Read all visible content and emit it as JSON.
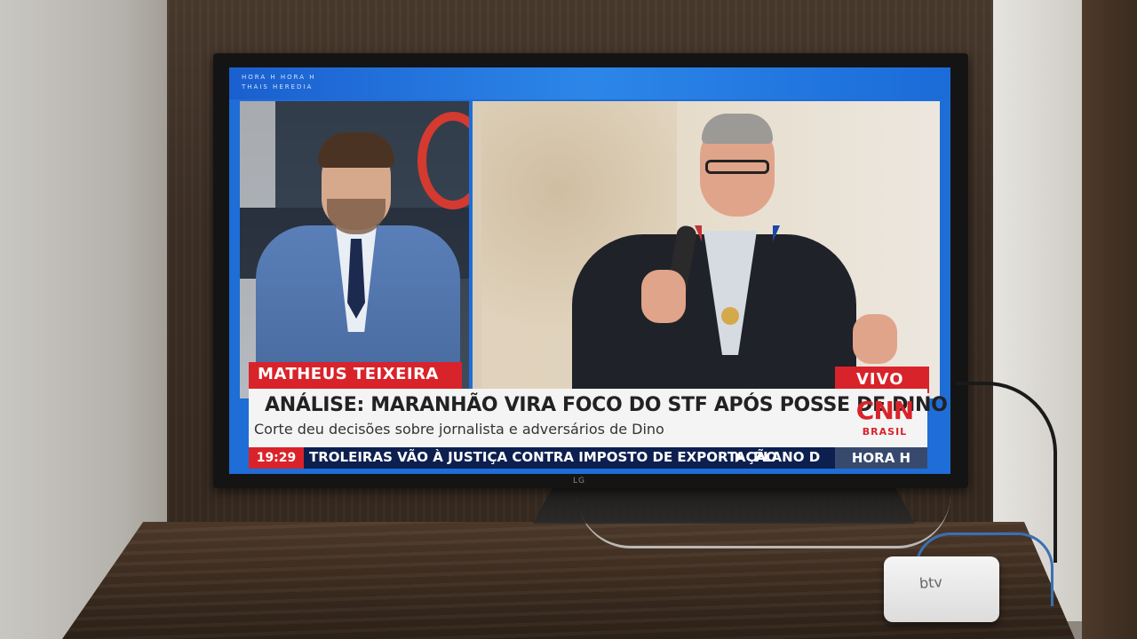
{
  "tv_brand": "LG",
  "broadcast": {
    "top_strip_text": [
      "HORA H  HORA H",
      "THAIS HEREDIA"
    ],
    "reporter_name": "MATHEUS TEIXEIRA",
    "live_label": "VIVO",
    "headline": "ANÁLISE: MARANHÃO VIRA FOCO DO STF APÓS POSSE DE DINO",
    "subheadline": "Corte deu decisões sobre jornalista e adversários de Dino",
    "channel": {
      "name": "CNN",
      "region": "BRASIL"
    },
    "ticker": {
      "time": "19:29",
      "text": "TROLEIRAS VÃO À JUSTIÇA CONTRA IMPOSTO DE EXPORTAÇÃO",
      "next": "PLANO D",
      "show": "HORA H"
    }
  },
  "set_top_box_label": "btv",
  "colors": {
    "cnn_red": "#d9232a",
    "ticker_navy": "#0c1f4f",
    "frame_blue": "#1f6dd6"
  }
}
